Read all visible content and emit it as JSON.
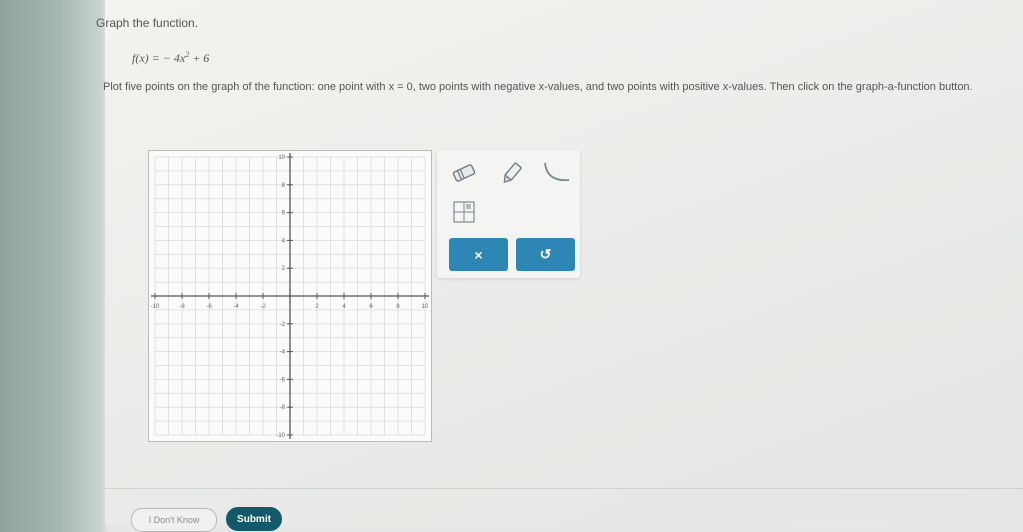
{
  "question": {
    "prompt": "Graph the function.",
    "formula_prefix": "f(x) = − 4x",
    "formula_exponent": "2",
    "formula_suffix": " + 6",
    "instructions": "Plot five points on the graph of the function: one point with x = 0, two points with negative x-values, and two points with positive x-values. Then click on the graph-a-function button."
  },
  "graph": {
    "x_range": [
      -10,
      10
    ],
    "y_range": [
      -10,
      10
    ],
    "x_tick_labels": [
      "-10",
      "-8",
      "-6",
      "-4",
      "-2",
      "2",
      "4",
      "6",
      "8",
      "10"
    ],
    "y_tick_labels": [
      "10",
      "8",
      "6",
      "4",
      "2",
      "-2",
      "-4",
      "-6",
      "-8",
      "-10"
    ],
    "grid": true,
    "axis_color": "#555555",
    "grid_color": "#d9dcdc"
  },
  "toolbar": {
    "eraser_icon": "eraser-icon",
    "pencil_icon": "pencil-icon",
    "curve_icon": "parabola-curve-icon",
    "grid_icon": "function-grid-icon",
    "clear_label": "×",
    "undo_label": "↺",
    "button_color": "#2e86b5"
  },
  "footer": {
    "dont_know_label": "I Don't Know",
    "submit_label": "Submit",
    "submit_color": "#14596a"
  }
}
